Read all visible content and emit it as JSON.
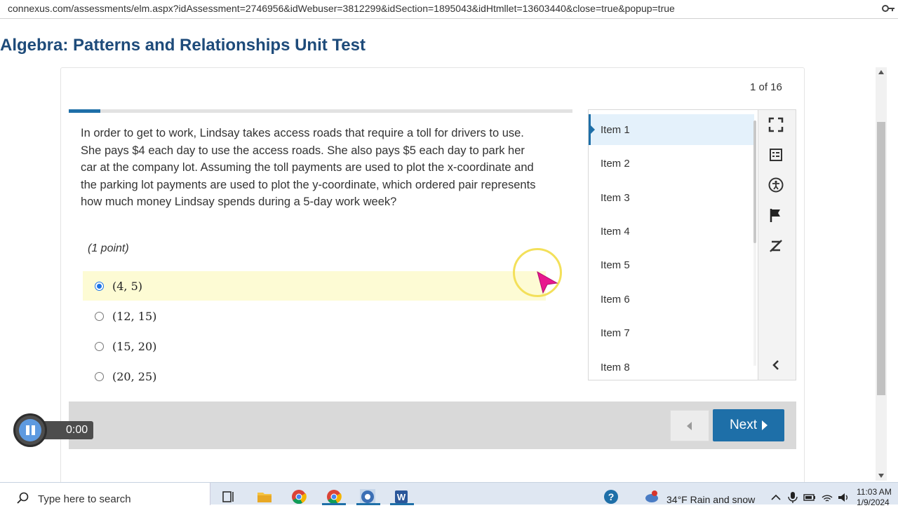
{
  "browser": {
    "url": "connexus.com/assessments/elm.aspx?idAssessment=2746956&idWebuser=3812299&idSection=1895043&idHtmllet=13603440&close=true&popup=true"
  },
  "page": {
    "title": "Algebra: Patterns and Relationships Unit Test",
    "counter": "1 of 16",
    "progress_fraction": 0.0625
  },
  "question": {
    "text": "In order to get to work, Lindsay takes access roads that require a toll for drivers to use. She pays $4 each day to use the access roads. She also pays $5 each day to park her car at the company lot.  Assuming the toll payments are used to plot the x-coordinate and the parking lot payments are used to plot the y-coordinate, which ordered pair represents how much money Lindsay spends during a 5-day work week?",
    "points": "(1 point)",
    "options": [
      {
        "label": "(4, 5)",
        "selected": true
      },
      {
        "label": "(12, 15)",
        "selected": false
      },
      {
        "label": "(15, 20)",
        "selected": false
      },
      {
        "label": "(20, 25)",
        "selected": false
      }
    ]
  },
  "item_list": {
    "items": [
      "Item 1",
      "Item 2",
      "Item 3",
      "Item 4",
      "Item 5",
      "Item 6",
      "Item 7",
      "Item 8"
    ],
    "active_index": 0
  },
  "tools": [
    "fullscreen-icon",
    "reference-sheet-icon",
    "accessibility-icon",
    "flag-icon",
    "eliminate-answer-icon",
    "collapse-chevron-icon"
  ],
  "navigation": {
    "next_label": "Next"
  },
  "audio_player": {
    "time": "0:00"
  },
  "taskbar": {
    "search_placeholder": "Type here to search",
    "weather": "34°F  Rain and snow",
    "time": "11:03 AM",
    "date": "1/9/2024"
  },
  "colors": {
    "accent": "#1e6fa8",
    "title": "#1e4b7a",
    "selected_bg": "#fdfbd4",
    "cursor_ring": "#f3e05a",
    "cursor_arrow": "#e8168e"
  }
}
